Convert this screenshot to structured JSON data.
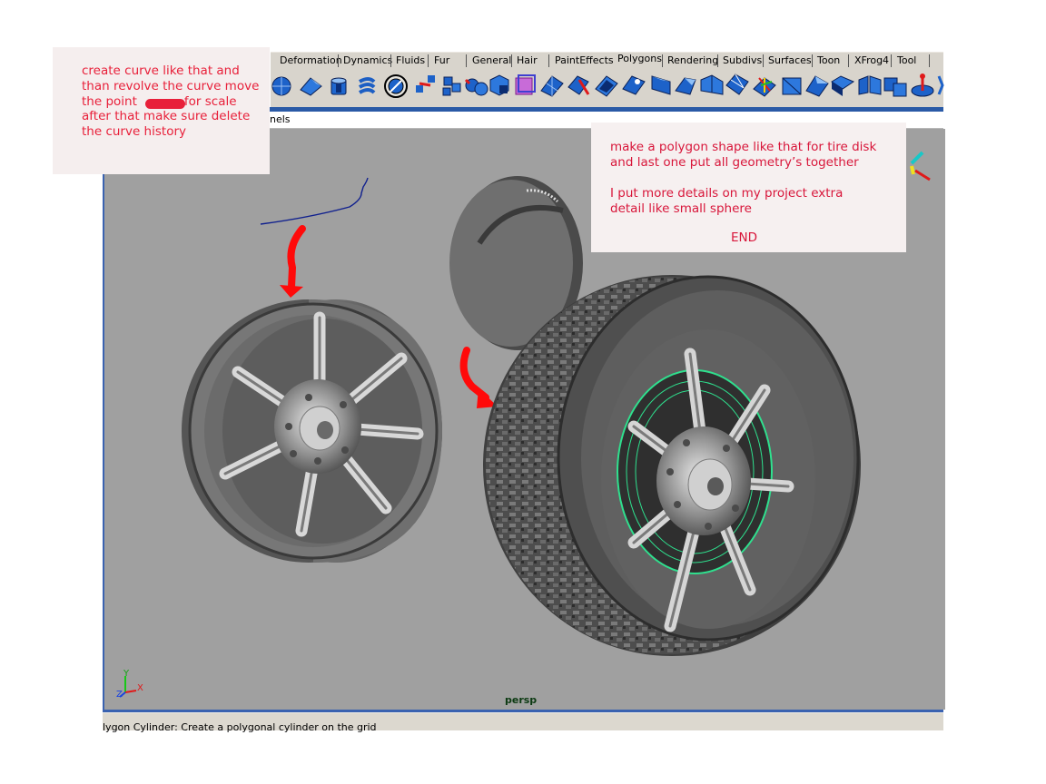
{
  "shelf": {
    "tabs": [
      {
        "label": "Deformation"
      },
      {
        "label": "Dynamics"
      },
      {
        "label": "Fluids"
      },
      {
        "label": "Fur"
      },
      {
        "label": "General"
      },
      {
        "label": "Hair"
      },
      {
        "label": "PaintEffects"
      },
      {
        "label": "Polygons"
      },
      {
        "label": "Rendering"
      },
      {
        "label": "Subdivs"
      },
      {
        "label": "Surfaces"
      },
      {
        "label": "Toon"
      },
      {
        "label": "XFrog4"
      },
      {
        "label": "Tool"
      }
    ],
    "selected_tab": "Polygons",
    "accent": "#2a5aa6"
  },
  "panel_menu": {
    "partial_label": "nels"
  },
  "viewport": {
    "camera_label": "persp",
    "axis_y": "Y",
    "axis_z": "Z",
    "axis_x": "X",
    "background": "#a0a0a0"
  },
  "status": {
    "help_line": "lygon Cylinder: Create a polygonal cylinder on the grid"
  },
  "note_left": {
    "line1": "create curve like that and",
    "line2": "than revolve the curve move",
    "line3a": "the point",
    "line3b": "for scale",
    "line4": "after that make sure delete",
    "line5": "the curve history",
    "text_color": "#e8203a"
  },
  "note_right": {
    "line1": "make a polygon shape like that for tire disk",
    "line2": "and last one put all geometry’s together",
    "line3": "I put more details on my project extra",
    "line4": "detail like small sphere",
    "end": "END",
    "text_color": "#d8163a"
  }
}
